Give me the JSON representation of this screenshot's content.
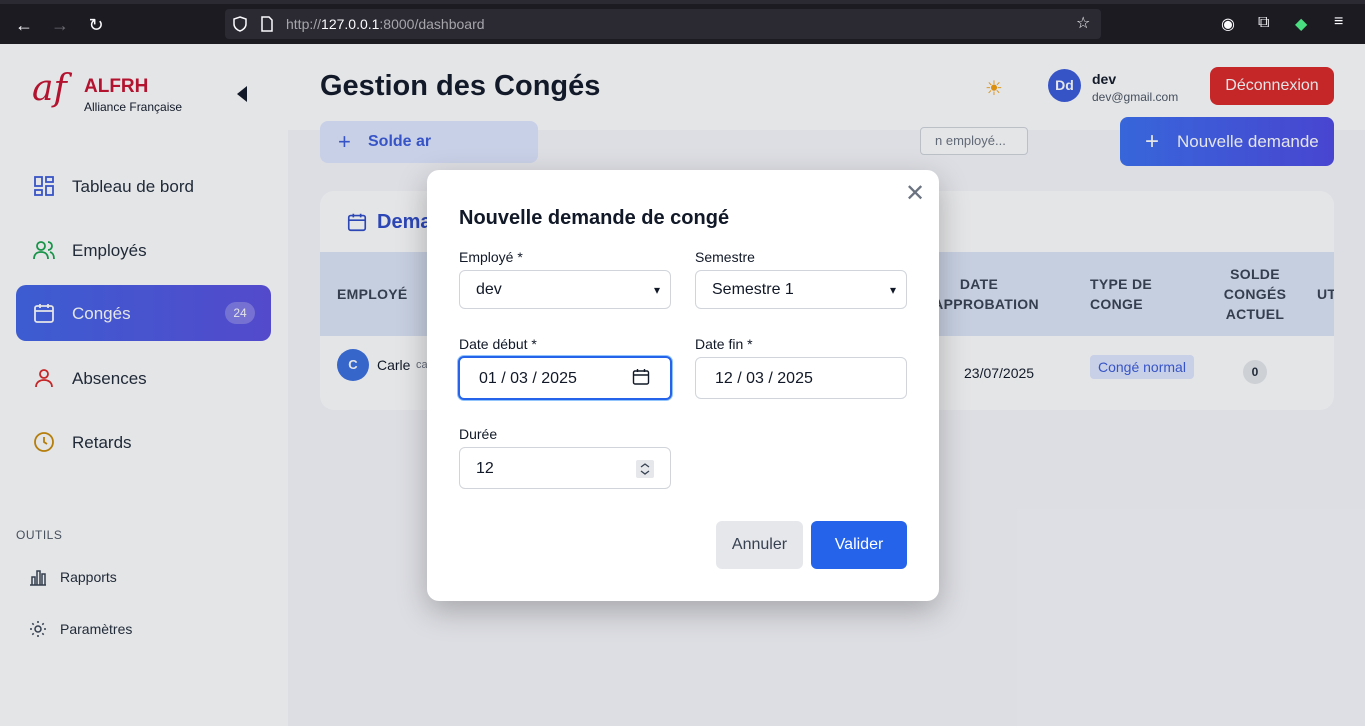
{
  "browser": {
    "url_prefix": "http://",
    "url_host": "127.0.0.1",
    "url_rest": ":8000/dashboard"
  },
  "sidebar": {
    "logo": "af",
    "brand": "ALFRH",
    "brand_sub": "Alliance Française",
    "items": [
      {
        "label": "Tableau de bord",
        "icon": "dashboard-grid-icon"
      },
      {
        "label": "Employés",
        "icon": "users-icon"
      },
      {
        "label": "Congés",
        "icon": "calendar-icon",
        "badge": "24",
        "active": true
      },
      {
        "label": "Absences",
        "icon": "user-icon"
      },
      {
        "label": "Retards",
        "icon": "clock-icon"
      }
    ],
    "section_title": "OUTILS",
    "tools": [
      {
        "label": "Rapports",
        "icon": "bar-chart-icon"
      },
      {
        "label": "Paramètres",
        "icon": "gear-icon"
      }
    ]
  },
  "header": {
    "title": "Gestion des Congés",
    "avatar_initials": "Dd",
    "user_name": "dev",
    "user_email": "dev@gmail.com",
    "logout_label": "Déconnexion"
  },
  "content": {
    "solde_button": "Solde ar",
    "search_placeholder": "n employé...",
    "new_request_button": "Nouvelle demande",
    "card_title": "Dema",
    "columns": [
      "EMPLOYÉ",
      "DATE D'APPROBATION",
      "TYPE DE CONGE",
      "SOLDE CONGÉS ACTUEL",
      "UT"
    ],
    "col_date_1": "DATE",
    "col_date_2": "D'APPROBATION",
    "col_type_1": "TYPE DE",
    "col_type_2": "CONGE",
    "col_solde_1": "SOLDE",
    "col_solde_2": "CONGÉS",
    "col_solde_3": "ACTUEL",
    "col_ut": "UT",
    "row": {
      "avatar": "C",
      "name": "Carle",
      "name_sub": "ca",
      "approval_date": "23/07/2025",
      "type": "Congé normal",
      "solde": "0"
    }
  },
  "modal": {
    "title": "Nouvelle demande de congé",
    "employee_label": "Employé *",
    "employee_value": "dev",
    "semester_label": "Semestre",
    "semester_value": "Semestre 1",
    "start_label": "Date début *",
    "start_value": "01 / 03 / 2025",
    "end_label": "Date fin *",
    "end_value": "12 / 03 / 2025",
    "duration_label": "Durée",
    "duration_value": "12",
    "cancel_label": "Annuler",
    "validate_label": "Valider"
  }
}
